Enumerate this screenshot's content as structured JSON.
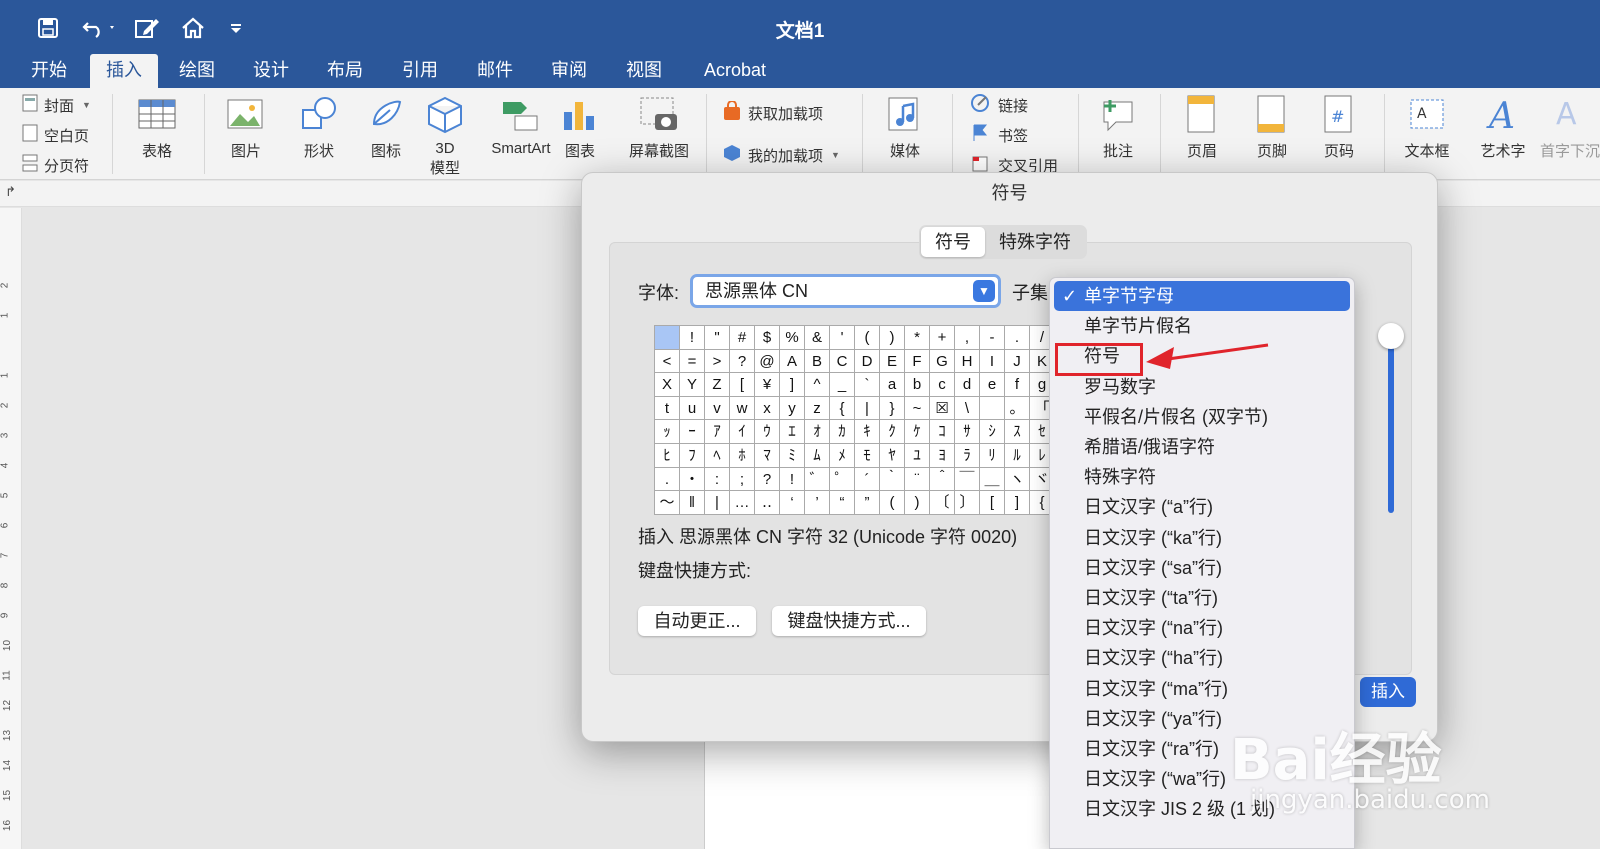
{
  "window": {
    "title": "文档1"
  },
  "tabs": [
    {
      "label": "开始",
      "active": false
    },
    {
      "label": "插入",
      "active": true
    },
    {
      "label": "绘图",
      "active": false
    },
    {
      "label": "设计",
      "active": false
    },
    {
      "label": "布局",
      "active": false
    },
    {
      "label": "引用",
      "active": false
    },
    {
      "label": "邮件",
      "active": false
    },
    {
      "label": "审阅",
      "active": false
    },
    {
      "label": "视图",
      "active": false
    },
    {
      "label": "Acrobat",
      "active": false
    }
  ],
  "ribbon": {
    "pages": [
      "封面",
      "空白页",
      "分页符"
    ],
    "table": "表格",
    "picture": "图片",
    "shapes": "形状",
    "icons": "图标",
    "model3d_line1": "3D",
    "model3d_line2": "模型",
    "smartart": "SmartArt",
    "chart": "图表",
    "screenshot": "屏幕截图",
    "get_addins": "获取加载项",
    "my_addins": "我的加载项",
    "media": "媒体",
    "link": "链接",
    "bookmark": "书签",
    "crossref": "交叉引用",
    "comment": "批注",
    "header": "页眉",
    "footer": "页脚",
    "page_number": "页码",
    "textbox": "文本框",
    "wordart": "艺术字",
    "dropcap": "首字下沉"
  },
  "ruler_numbers": [
    "2",
    "1",
    "1",
    "2",
    "3",
    "4",
    "5",
    "6",
    "7",
    "8",
    "9",
    "10",
    "11",
    "12",
    "13",
    "14",
    "15",
    "16"
  ],
  "dialog": {
    "title": "符号",
    "tabs": [
      "符号",
      "特殊字符"
    ],
    "font_label": "字体:",
    "font_value": "思源黑体 CN",
    "subset_label": "子集",
    "info_text": "插入 思源黑体 CN 字符 32 (Unicode 字符 0020)",
    "shortcut_label": "键盘快捷方式:",
    "autocorrect_button": "自动更正...",
    "shortcut_button": "键盘快捷方式...",
    "insert_button": "插入"
  },
  "symbol_grid": [
    [
      "",
      "!",
      "\"",
      "#",
      "$",
      "%",
      "&",
      "'",
      "(",
      ")",
      "*",
      "+",
      ",",
      "-",
      ".",
      "/"
    ],
    [
      "<",
      "=",
      ">",
      "?",
      "@",
      "A",
      "B",
      "C",
      "D",
      "E",
      "F",
      "G",
      "H",
      "I",
      "J",
      "K"
    ],
    [
      "X",
      "Y",
      "Z",
      "[",
      "¥",
      "]",
      "^",
      "_",
      "`",
      "a",
      "b",
      "c",
      "d",
      "e",
      "f",
      "g"
    ],
    [
      "t",
      "u",
      "v",
      "w",
      "x",
      "y",
      "z",
      "{",
      "|",
      "}",
      "~",
      "☒",
      "\\",
      "",
      "。",
      "「"
    ],
    [
      "ｯ",
      "ｰ",
      "ｱ",
      "ｲ",
      "ｳ",
      "ｴ",
      "ｵ",
      "ｶ",
      "ｷ",
      "ｸ",
      "ｹ",
      "ｺ",
      "ｻ",
      "ｼ",
      "ｽ",
      "ｾ"
    ],
    [
      "ﾋ",
      "ﾌ",
      "ﾍ",
      "ﾎ",
      "ﾏ",
      "ﾐ",
      "ﾑ",
      "ﾒ",
      "ﾓ",
      "ﾔ",
      "ﾕ",
      "ﾖ",
      "ﾗ",
      "ﾘ",
      "ﾙ",
      "ﾚ"
    ],
    [
      ".",
      "・",
      ":",
      ";",
      "?",
      "!",
      "゛",
      "゜",
      "´",
      "｀",
      "¨",
      "＾",
      "￣",
      "＿",
      "ヽ",
      "ヾ"
    ],
    [
      "〜",
      "‖",
      "|",
      "…",
      "‥",
      "‘",
      "’",
      "“",
      "”",
      "(",
      ")",
      "〔",
      "〕",
      "[",
      "]",
      "{"
    ]
  ],
  "subset_menu": [
    {
      "label": "单字节字母",
      "checked": true
    },
    {
      "label": "单字节片假名",
      "checked": false
    },
    {
      "label": "符号",
      "checked": false
    },
    {
      "label": "罗马数字",
      "checked": false
    },
    {
      "label": "平假名/片假名 (双字节)",
      "checked": false
    },
    {
      "label": "希腊语/俄语字符",
      "checked": false
    },
    {
      "label": "特殊字符",
      "checked": false
    },
    {
      "label": "日文汉字 (“a”行)",
      "checked": false
    },
    {
      "label": "日文汉字 (“ka”行)",
      "checked": false
    },
    {
      "label": "日文汉字 (“sa”行)",
      "checked": false
    },
    {
      "label": "日文汉字 (“ta”行)",
      "checked": false
    },
    {
      "label": "日文汉字 (“na”行)",
      "checked": false
    },
    {
      "label": "日文汉字 (“ha”行)",
      "checked": false
    },
    {
      "label": "日文汉字 (“ma”行)",
      "checked": false
    },
    {
      "label": "日文汉字 (“ya”行)",
      "checked": false
    },
    {
      "label": "日文汉字 (“ra”行)",
      "checked": false
    },
    {
      "label": "日文汉字 (“wa”行)",
      "checked": false
    },
    {
      "label": "日文汉字 JIS 2 级 (1 划)",
      "checked": false
    }
  ],
  "watermark": {
    "logo": "Bai经验",
    "url": "jingyan.baidu.com"
  },
  "colors": {
    "brand": "#2b579a",
    "accent": "#3a73db",
    "highlight": "#e0242b"
  }
}
